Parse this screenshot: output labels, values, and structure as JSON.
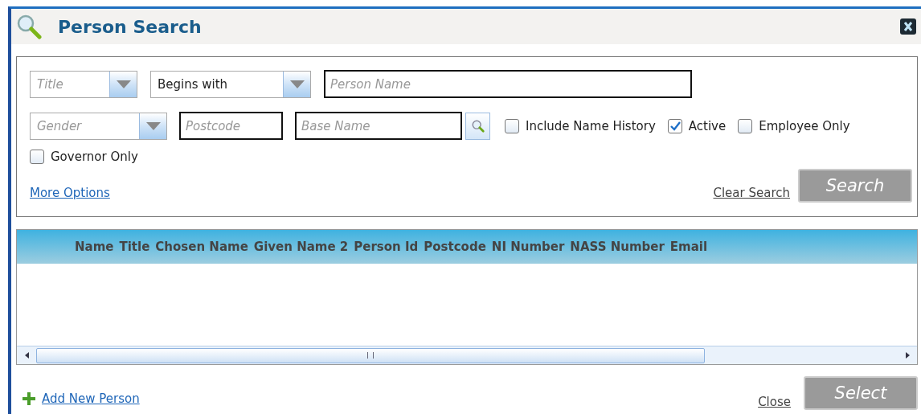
{
  "window": {
    "title": "Person Search"
  },
  "filters": {
    "title_select": {
      "placeholder": "Title"
    },
    "match_select": {
      "value": "Begins with"
    },
    "person_name": {
      "placeholder": "Person Name"
    },
    "gender_select": {
      "placeholder": "Gender"
    },
    "postcode": {
      "placeholder": "Postcode"
    },
    "base_name": {
      "placeholder": "Base Name"
    }
  },
  "options": [
    {
      "label": "Include Name History",
      "checked": false
    },
    {
      "label": "Active",
      "checked": true
    },
    {
      "label": "Employee Only",
      "checked": false
    },
    {
      "label": "Governor Only",
      "checked": false
    }
  ],
  "more_options": "More Options",
  "clear_search": "Clear Search",
  "search_button": {
    "label": "Search",
    "disabled": true
  },
  "table": {
    "columns": [
      "Name",
      "Title",
      "Chosen Name",
      "Given Name 2",
      "Person Id",
      "Postcode",
      "NI Number",
      "NASS Number",
      "Email"
    ]
  },
  "footer": {
    "add_new": "Add New Person",
    "close": "Close",
    "select_button": {
      "label": "Select",
      "disabled": true
    }
  }
}
